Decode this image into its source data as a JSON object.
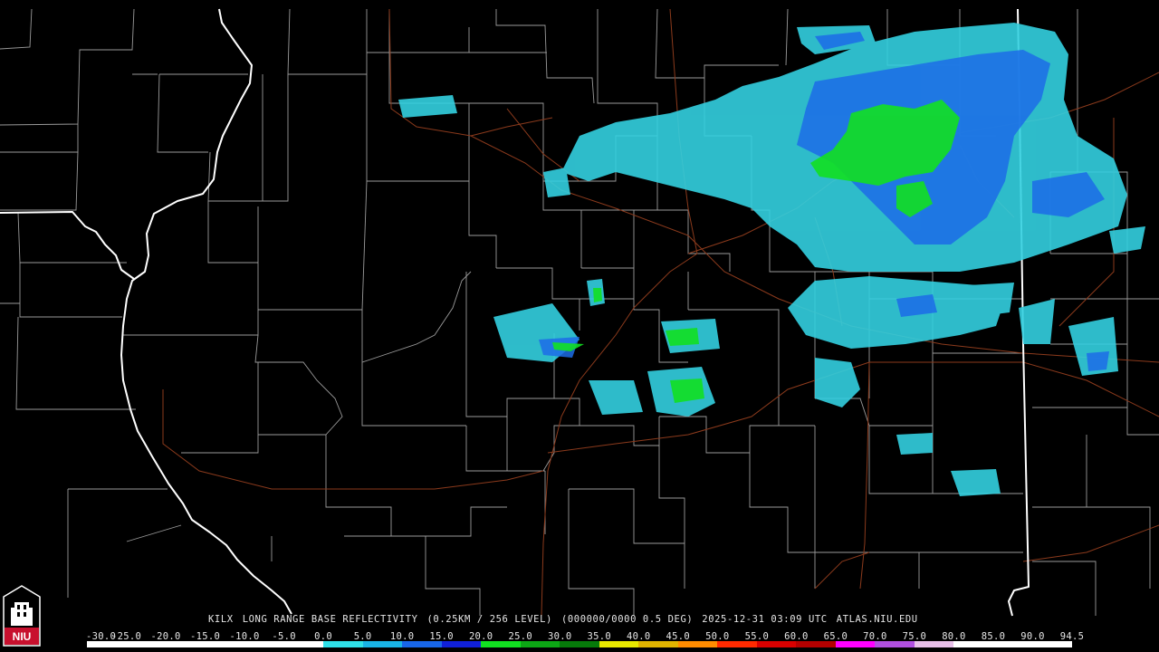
{
  "caption": {
    "station": "KILX",
    "product": "LONG RANGE BASE REFLECTIVITY",
    "resolution": "(0.25KM / 256 LEVEL)",
    "volume": "(000000/0000 0.5 DEG)",
    "timestamp": "2025-12-31 03:09 UTC",
    "source": "ATLAS.NIU.EDU"
  },
  "logo": {
    "text": "NIU",
    "icon": "niu-tower-logo-icon"
  },
  "scale": {
    "labels": [
      "-30.0",
      "-25.0",
      "-20.0",
      "-15.0",
      "-10.0",
      "-5.0",
      "0.0",
      "5.0",
      "10.0",
      "15.0",
      "20.0",
      "25.0",
      "30.0",
      "35.0",
      "40.0",
      "45.0",
      "50.0",
      "55.0",
      "60.0",
      "65.0",
      "70.0",
      "75.0",
      "80.0",
      "85.0",
      "90.0",
      "94.5"
    ],
    "colors": [
      "#ffffff",
      "#ffffff",
      "#ffffff",
      "#ffffff",
      "#ffffff",
      "#ffffff",
      "#2fe0e8",
      "#19b4e6",
      "#1866e8",
      "#1020d8",
      "#11e021",
      "#0ca615",
      "#067a0a",
      "#e8e800",
      "#e0b400",
      "#ff8c00",
      "#ff2a00",
      "#d80000",
      "#b40000",
      "#ff00ff",
      "#b04fe0",
      "#e7bfe8",
      "#ffffff",
      "#ffffff",
      "#ffffff"
    ]
  },
  "colors": {
    "background": "#000000",
    "county_lines": "#9a9a9a",
    "state_lines": "#ffffff",
    "highways": "#8b3a1c",
    "echo_light": "#33d0e0",
    "echo_medium": "#1c6ce8",
    "echo_strong": "#12e022"
  }
}
